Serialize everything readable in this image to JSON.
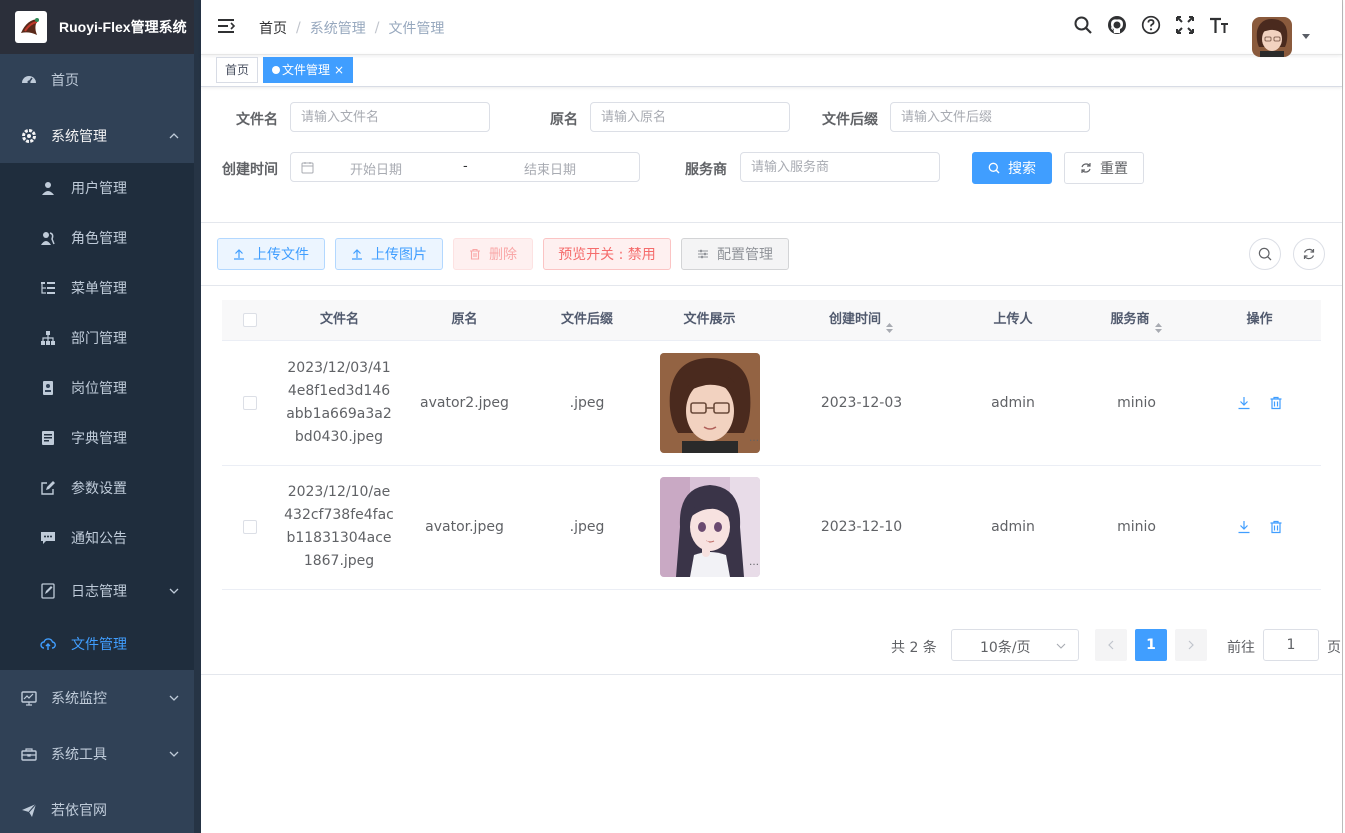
{
  "app": {
    "title": "Ruoyi-Flex管理系统"
  },
  "sidebar": {
    "items": [
      {
        "label": "首页",
        "icon": "dashboard-icon"
      },
      {
        "label": "系统管理",
        "icon": "gear-icon",
        "expanded": true
      },
      {
        "label": "系统监控",
        "icon": "monitor-icon"
      },
      {
        "label": "系统工具",
        "icon": "toolbox-icon"
      },
      {
        "label": "若依官网",
        "icon": "send-icon"
      }
    ],
    "sub_items": [
      {
        "label": "用户管理",
        "icon": "user-icon"
      },
      {
        "label": "角色管理",
        "icon": "role-icon"
      },
      {
        "label": "菜单管理",
        "icon": "tree-table-icon"
      },
      {
        "label": "部门管理",
        "icon": "tree-icon"
      },
      {
        "label": "岗位管理",
        "icon": "post-icon"
      },
      {
        "label": "字典管理",
        "icon": "dict-icon"
      },
      {
        "label": "参数设置",
        "icon": "edit-icon"
      },
      {
        "label": "通知公告",
        "icon": "message-icon"
      },
      {
        "label": "日志管理",
        "icon": "log-icon"
      },
      {
        "label": "文件管理",
        "icon": "upload-cloud-icon",
        "active": true
      }
    ]
  },
  "breadcrumb": [
    "首页",
    "系统管理",
    "文件管理"
  ],
  "tags": [
    {
      "label": "首页",
      "active": false
    },
    {
      "label": "文件管理",
      "active": true,
      "close": "×"
    }
  ],
  "search": {
    "file_name_label": "文件名",
    "file_name_placeholder": "请输入文件名",
    "original_name_label": "原名",
    "original_name_placeholder": "请输入原名",
    "suffix_label": "文件后缀",
    "suffix_placeholder": "请输入文件后缀",
    "create_time_label": "创建时间",
    "start_date": "开始日期",
    "date_separator": "-",
    "end_date": "结束日期",
    "service_label": "服务商",
    "service_placeholder": "请输入服务商",
    "search_button": "搜索",
    "reset_button": "重置"
  },
  "toolbar": {
    "upload_file": "上传文件",
    "upload_image": "上传图片",
    "delete": "删除",
    "preview_toggle": "预览开关 : 禁用",
    "config": "配置管理"
  },
  "table": {
    "columns": [
      "文件名",
      "原名",
      "文件后缀",
      "文件展示",
      "创建时间",
      "上传人",
      "服务商",
      "操作"
    ],
    "rows": [
      {
        "file_name": "2023/12/03/414e8f1ed3d146abb1a669a3a2bd0430.jpeg",
        "original_name": "avator2.jpeg",
        "suffix": ".jpeg",
        "created": "2023-12-03",
        "uploader": "admin",
        "service": "minio"
      },
      {
        "file_name": "2023/12/10/ae432cf738fe4facb11831304ace1867.jpeg",
        "original_name": "avator.jpeg",
        "suffix": ".jpeg",
        "created": "2023-12-10",
        "uploader": "admin",
        "service": "minio"
      }
    ]
  },
  "pagination": {
    "total_text": "共 2 条",
    "page_size": "10条/页",
    "current_page": "1",
    "goto_label": "前往",
    "goto_value": "1",
    "page_unit": "页"
  },
  "colors": {
    "sidebar_bg": "#304156",
    "submenu_bg": "#1f2d3d",
    "primary": "#409eff",
    "danger": "#f56c6c"
  }
}
